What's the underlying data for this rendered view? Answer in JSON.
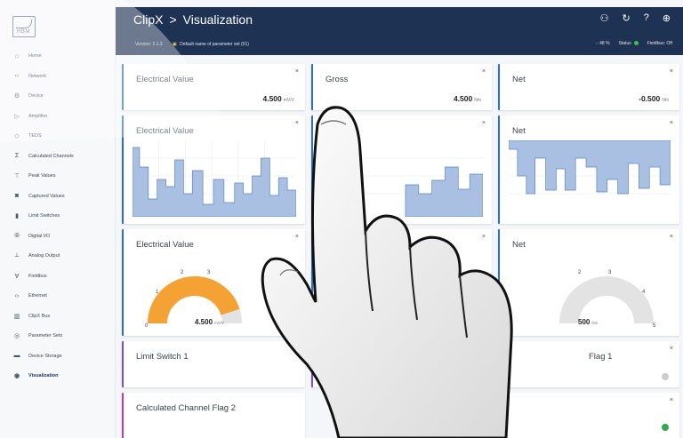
{
  "app": {
    "title": "ClipX",
    "section": "Visualization",
    "sep": ">",
    "logo_text": "HBM"
  },
  "topbar": {
    "version": "Version: 2.1.3",
    "params": "Default name of parameter set (01)",
    "cpu": "48 %",
    "status_label": "Status",
    "fieldbus": "Fieldbus: Off"
  },
  "sidebar": {
    "items": [
      {
        "label": "Home",
        "icon": "home-icon",
        "glyph": "⌂"
      },
      {
        "label": "Network",
        "icon": "network-icon",
        "glyph": "‹›"
      },
      {
        "label": "Device",
        "icon": "device-icon",
        "glyph": "⚙"
      },
      {
        "label": "Amplifier",
        "icon": "amplifier-icon",
        "glyph": "▷"
      },
      {
        "label": "TEDS",
        "icon": "teds-icon",
        "glyph": "◇"
      },
      {
        "label": "Calculated Channels",
        "icon": "sigma-icon",
        "glyph": "Σ"
      },
      {
        "label": "Peak Values",
        "icon": "peak-icon",
        "glyph": "⊤"
      },
      {
        "label": "Captured Values",
        "icon": "camera-icon",
        "glyph": "◙"
      },
      {
        "label": "Limit Switches",
        "icon": "limit-icon",
        "glyph": "▮"
      },
      {
        "label": "Digital I/O",
        "icon": "digital-io-icon",
        "glyph": "⦾"
      },
      {
        "label": "Analog Output",
        "icon": "analog-output-icon",
        "glyph": "⟂"
      },
      {
        "label": "Fieldbus",
        "icon": "fieldbus-icon",
        "glyph": "∀"
      },
      {
        "label": "Ethernet",
        "icon": "ethernet-icon",
        "glyph": "‹›"
      },
      {
        "label": "ClipX Bus",
        "icon": "bus-icon",
        "glyph": "▥"
      },
      {
        "label": "Parameter Sets",
        "icon": "parameter-sets-icon",
        "glyph": "◎"
      },
      {
        "label": "Device Storage",
        "icon": "storage-icon",
        "glyph": "▬"
      },
      {
        "label": "Visualization",
        "icon": "visualization-icon",
        "glyph": "◉"
      }
    ]
  },
  "cards": {
    "r1c1": {
      "title": "Electrical Value",
      "value": "4.500",
      "unit": "mV/V"
    },
    "r1c2": {
      "title": "Gross",
      "value": "4.500",
      "unit": "Nm"
    },
    "r1c3": {
      "title": "Net",
      "value": "-0.500",
      "unit": "Nm"
    },
    "r2c1": {
      "title": "Electrical Value"
    },
    "r2c3": {
      "title": "Net"
    },
    "r3c1": {
      "title": "Electrical Value",
      "value": "4.500",
      "unit": "mV/V"
    },
    "r3c2": {
      "title": "G"
    },
    "r3c3": {
      "title": "Net",
      "value": "500",
      "unit": "Nm"
    },
    "r4c1": {
      "title": "Limit Switch 1"
    },
    "r4c2": {
      "title": "Li"
    },
    "r4c3": {
      "title": "Flag 1"
    },
    "r5c1": {
      "title": "Calculated Channel Flag 2"
    },
    "close": "×"
  },
  "gauge_left": {
    "ticks": [
      "0",
      "1",
      "2",
      "3"
    ],
    "fraction": 0.9
  },
  "gauge_right": {
    "ticks": [
      "2",
      "3",
      "4",
      "5"
    ],
    "fraction": 0.9
  },
  "colors": {
    "topbar": "#1e3254",
    "accent_blue": "#2a6fc0",
    "gauge_orange": "#f5a234",
    "bars": "#a9c0e3",
    "status_green": "#3cc14a"
  }
}
